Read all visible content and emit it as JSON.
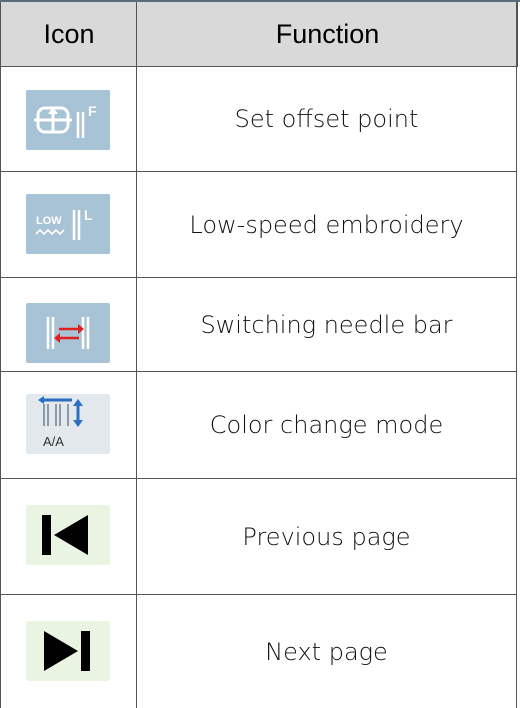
{
  "table": {
    "headers": {
      "icon": "Icon",
      "function": "Function"
    },
    "rows": [
      {
        "icon": "set-offset-point-icon",
        "icon_letter": "F",
        "function": "Set offset point"
      },
      {
        "icon": "low-speed-embroidery-icon",
        "icon_text": "LOW",
        "icon_letter": "L",
        "function": "Low-speed embroidery"
      },
      {
        "icon": "switching-needle-bar-icon",
        "function": "Switching needle bar"
      },
      {
        "icon": "color-change-mode-icon",
        "icon_text": "A/A",
        "function": "Color change mode"
      },
      {
        "icon": "previous-page-icon",
        "function": "Previous page"
      },
      {
        "icon": "next-page-icon",
        "function": "Next page"
      }
    ]
  },
  "colors": {
    "header_bg": "#d9d9d9",
    "icon_blue": "#a9c3d6",
    "icon_green_bg": "#eaf4e3",
    "arrow_red": "#e02020",
    "arrow_blue": "#2a6fc0"
  }
}
